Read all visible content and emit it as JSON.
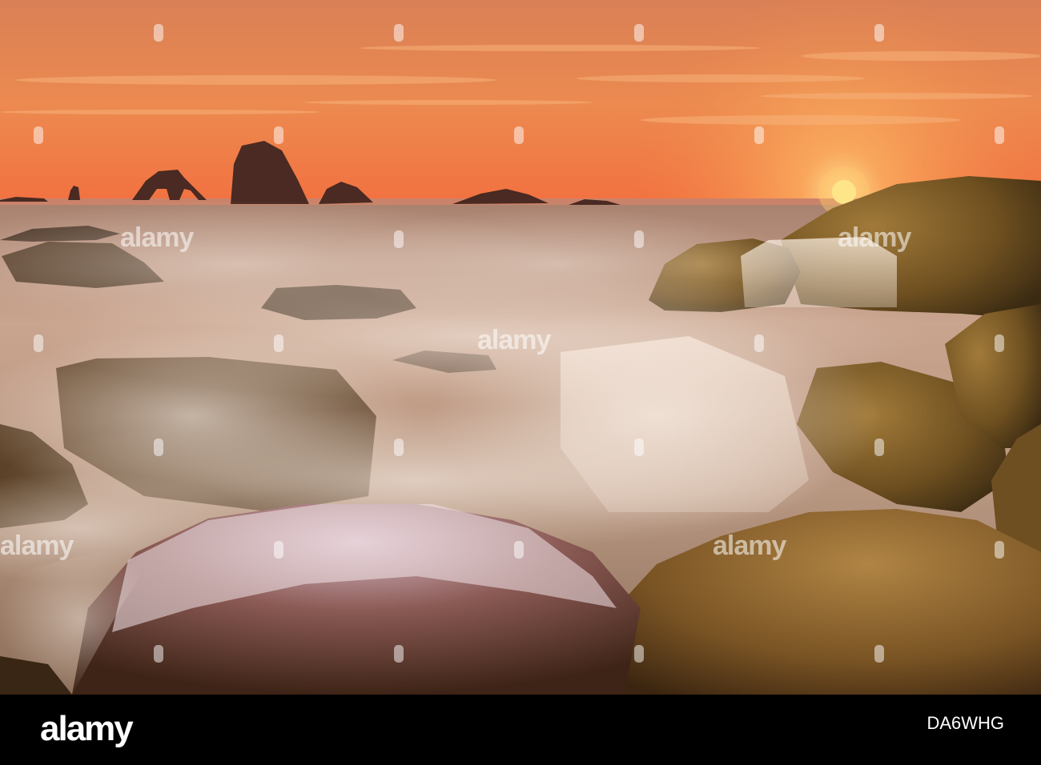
{
  "watermark": {
    "text": "alamy"
  },
  "footer": {
    "logo": "alamy",
    "image_id": "DA6WHG"
  },
  "colors": {
    "sky_top": "#e8894f",
    "sky_horizon": "#f4764a",
    "sun": "#ffd85a",
    "rock_moss": "#7e5a25",
    "surf": "#e8d8cc",
    "footer_bg": "#000000"
  }
}
